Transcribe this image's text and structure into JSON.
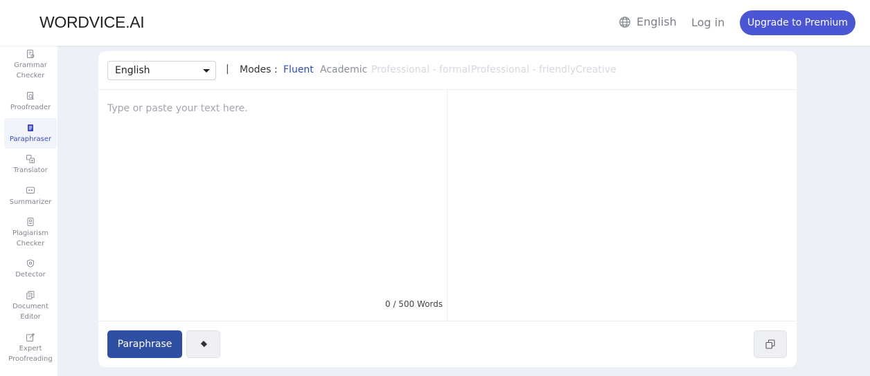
{
  "header": {
    "logo": "WORDVICE.AI",
    "language_link": "English",
    "login": "Log in",
    "upgrade": "Upgrade to Premium"
  },
  "sidebar": {
    "items": [
      {
        "label": "Grammar Checker",
        "icon": "grammar-icon",
        "active": false
      },
      {
        "label": "Proofreader",
        "icon": "proofreader-icon",
        "active": false
      },
      {
        "label": "Paraphraser",
        "icon": "paraphraser-icon",
        "active": true
      },
      {
        "label": "Translator",
        "icon": "translator-icon",
        "active": false
      },
      {
        "label": "Summarizer",
        "icon": "summarizer-icon",
        "active": false
      },
      {
        "label": "Plagiarism Checker",
        "icon": "plagiarism-icon",
        "active": false
      },
      {
        "label": "Detector",
        "icon": "detector-icon",
        "active": false
      },
      {
        "label": "Document Editor",
        "icon": "document-editor-icon",
        "active": false
      },
      {
        "label": "Expert Proofreading",
        "icon": "expert-proofreading-icon",
        "active": false
      }
    ]
  },
  "editor": {
    "language": "English",
    "separator": "|",
    "modes_label": "Modes :",
    "modes": [
      {
        "label": "Fluent",
        "state": "selected"
      },
      {
        "label": "Academic",
        "state": "enabled"
      },
      {
        "label": "Professional - formal",
        "state": "disabled"
      },
      {
        "label": "Professional - friendly",
        "state": "disabled"
      },
      {
        "label": "Creative",
        "state": "disabled"
      }
    ],
    "placeholder": "Type or paste your text here.",
    "word_count": "0 / 500 Words",
    "paraphrase_button": "Paraphrase"
  },
  "colors": {
    "accent": "#4a56d4",
    "primary_button": "#2f4fa3",
    "selected_mode": "#2d4fa6",
    "background": "#eef0f7"
  }
}
